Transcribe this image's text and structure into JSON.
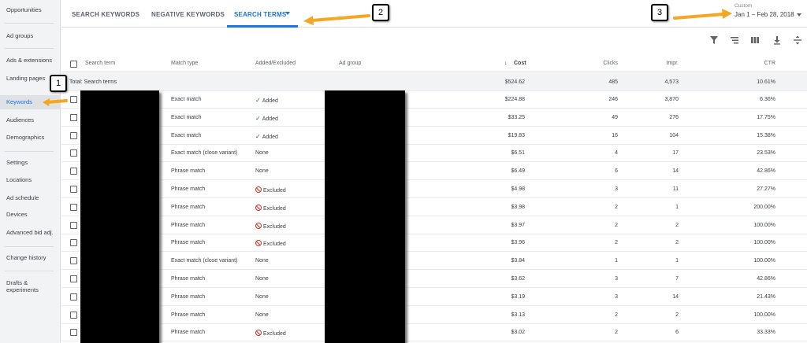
{
  "sidebar": {
    "items": [
      {
        "label": "Opportunities"
      },
      {
        "label": "Ad groups"
      },
      {
        "label": "Ads & extensions"
      },
      {
        "label": "Landing pages"
      },
      {
        "label": "Keywords",
        "active": true
      },
      {
        "label": "Audiences"
      },
      {
        "label": "Demographics"
      },
      {
        "label": "Settings"
      },
      {
        "label": "Locations"
      },
      {
        "label": "Ad schedule"
      },
      {
        "label": "Devices"
      },
      {
        "label": "Advanced bid adj."
      },
      {
        "label": "Change history"
      },
      {
        "label": "Drafts &\nexperiments"
      }
    ]
  },
  "tabs": [
    {
      "label": "SEARCH KEYWORDS"
    },
    {
      "label": "NEGATIVE KEYWORDS"
    },
    {
      "label": "SEARCH TERMS",
      "active": true
    }
  ],
  "date_range": {
    "label": "Custom",
    "value": "Jan 1 – Feb 28, 2018"
  },
  "toolbar": {
    "icons": [
      "filter-icon",
      "segment-icon",
      "columns-icon",
      "download-icon",
      "expand-icon"
    ]
  },
  "table": {
    "headers": {
      "search_term": "Search term",
      "match_type": "Match type",
      "added_excluded": "Added/Excluded",
      "ad_group": "Ad group",
      "cost": "Cost",
      "clicks": "Clicks",
      "impr": "Impr.",
      "ctr": "CTR"
    },
    "total": {
      "label": "Total: Search terms",
      "cost": "$524.62",
      "clicks": "485",
      "impr": "4,573",
      "ctr": "10.61%"
    },
    "rows": [
      {
        "match": "Exact match",
        "status": "Added",
        "cost": "$224.88",
        "clicks": "246",
        "impr": "3,870",
        "ctr": "6.36%"
      },
      {
        "match": "Exact match",
        "status": "Added",
        "cost": "$33.25",
        "clicks": "49",
        "impr": "276",
        "ctr": "17.75%"
      },
      {
        "match": "Exact match",
        "status": "Added",
        "cost": "$19.83",
        "clicks": "16",
        "impr": "104",
        "ctr": "15.38%"
      },
      {
        "match": "Exact match (close variant)",
        "status": "None",
        "cost": "$6.51",
        "clicks": "4",
        "impr": "17",
        "ctr": "23.53%"
      },
      {
        "match": "Phrase match",
        "status": "None",
        "cost": "$6.49",
        "clicks": "6",
        "impr": "14",
        "ctr": "42.86%"
      },
      {
        "match": "Phrase match",
        "status": "Excluded",
        "cost": "$4.98",
        "clicks": "3",
        "impr": "11",
        "ctr": "27.27%"
      },
      {
        "match": "Phrase match",
        "status": "Excluded",
        "cost": "$3.98",
        "clicks": "2",
        "impr": "1",
        "ctr": "200.00%"
      },
      {
        "match": "Phrase match",
        "status": "Excluded",
        "cost": "$3.97",
        "clicks": "2",
        "impr": "2",
        "ctr": "100.00%"
      },
      {
        "match": "Phrase match",
        "status": "Excluded",
        "cost": "$3.96",
        "clicks": "2",
        "impr": "2",
        "ctr": "100.00%"
      },
      {
        "match": "Exact match (close variant)",
        "status": "None",
        "cost": "$3.84",
        "clicks": "1",
        "impr": "1",
        "ctr": "100.00%"
      },
      {
        "match": "Phrase match",
        "status": "None",
        "cost": "$3.62",
        "clicks": "3",
        "impr": "7",
        "ctr": "42.86%"
      },
      {
        "match": "Phrase match",
        "status": "None",
        "cost": "$3.19",
        "clicks": "3",
        "impr": "14",
        "ctr": "21.43%"
      },
      {
        "match": "Phrase match",
        "status": "None",
        "cost": "$3.13",
        "clicks": "2",
        "impr": "2",
        "ctr": "100.00%"
      },
      {
        "match": "Phrase match",
        "status": "Excluded",
        "cost": "$3.02",
        "clicks": "2",
        "impr": "6",
        "ctr": "33.33%"
      }
    ]
  },
  "annotations": [
    {
      "label": "1"
    },
    {
      "label": "2"
    },
    {
      "label": "3"
    }
  ],
  "colors": {
    "accent": "#1a73e8",
    "added": "#188038",
    "excluded": "#d93025",
    "arrow": "#f5a623"
  }
}
